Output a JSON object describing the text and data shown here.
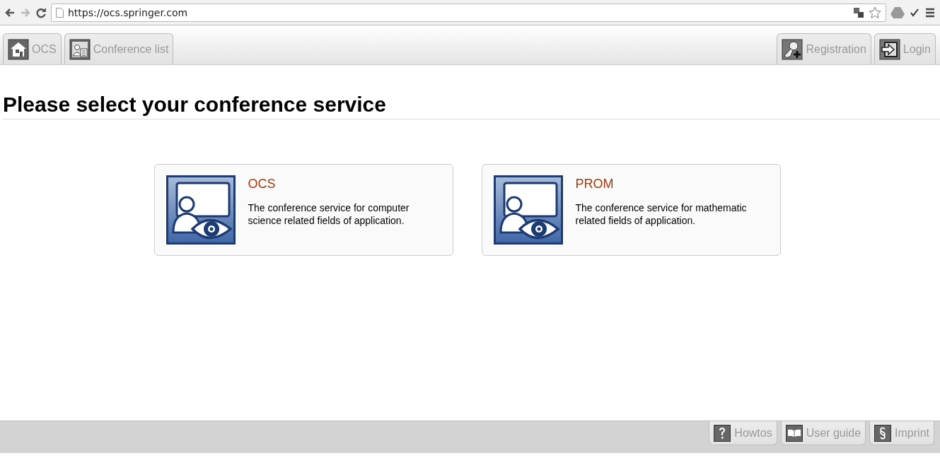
{
  "browser": {
    "url": "https://ocs.springer.com"
  },
  "nav": {
    "left": [
      {
        "label": "OCS"
      },
      {
        "label": "Conference list"
      }
    ],
    "right": [
      {
        "label": "Registration"
      },
      {
        "label": "Login"
      }
    ]
  },
  "heading": "Please select your conference service",
  "services": [
    {
      "title": "OCS",
      "description": "The conference service for computer science related fields of application."
    },
    {
      "title": "PROM",
      "description": "The conference service for mathematic related fields of application."
    }
  ],
  "footer": [
    {
      "label": "Howtos"
    },
    {
      "label": "User guide"
    },
    {
      "label": "Imprint"
    }
  ]
}
